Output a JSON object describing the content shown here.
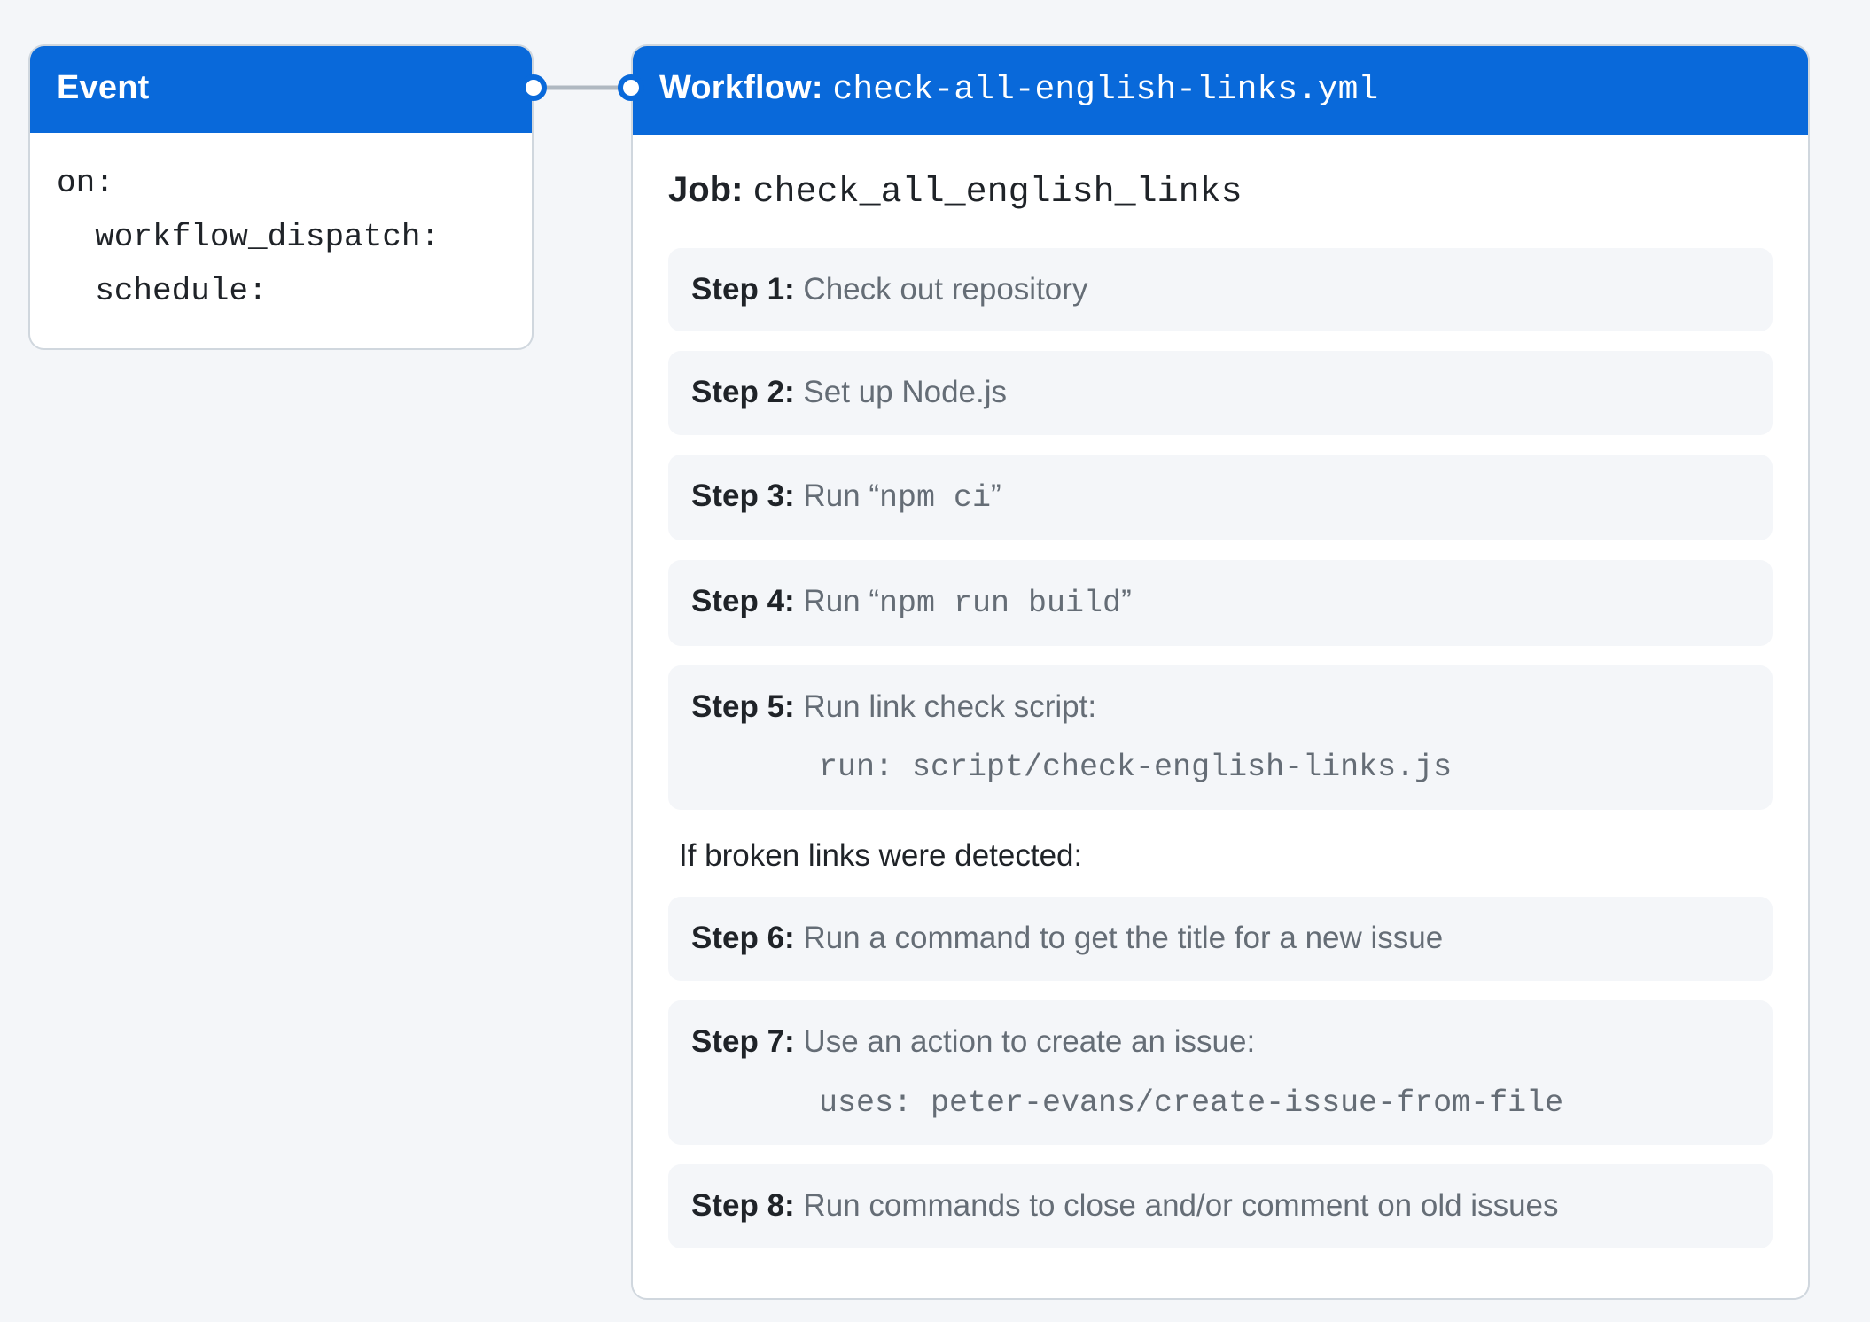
{
  "event": {
    "title": "Event",
    "body": "on:\n  workflow_dispatch:\n  schedule:"
  },
  "workflow": {
    "title_label": "Workflow: ",
    "filename": "check-all-english-links.yml",
    "job_label": "Job: ",
    "job_name": "check_all_english_links",
    "condition": "If broken links were detected:",
    "steps": [
      {
        "label": "Step 1:",
        "desc_prefix": "  Check out repository",
        "mono": "",
        "desc_suffix": "",
        "extra": ""
      },
      {
        "label": "Step 2:",
        "desc_prefix": "  Set up Node.js",
        "mono": "",
        "desc_suffix": "",
        "extra": ""
      },
      {
        "label": "Step 3:",
        "desc_prefix": "  Run “",
        "mono": "npm ci",
        "desc_suffix": "”",
        "extra": ""
      },
      {
        "label": "Step 4:",
        "desc_prefix": "  Run “",
        "mono": "npm run build",
        "desc_suffix": "”",
        "extra": ""
      },
      {
        "label": "Step 5:",
        "desc_prefix": "  Run link check script:",
        "mono": "",
        "desc_suffix": "",
        "extra": "run: script/check-english-links.js"
      }
    ],
    "steps_after": [
      {
        "label": "Step 6:",
        "desc_prefix": "  Run a command to get the title for a new issue",
        "mono": "",
        "desc_suffix": "",
        "extra": ""
      },
      {
        "label": "Step 7:",
        "desc_prefix": "  Use an action to create an issue:",
        "mono": "",
        "desc_suffix": "",
        "extra": "uses: peter-evans/create-issue-from-file"
      },
      {
        "label": "Step 8:",
        "desc_prefix": "  Run commands to close and/or comment on old issues",
        "mono": "",
        "desc_suffix": "",
        "extra": ""
      }
    ]
  }
}
